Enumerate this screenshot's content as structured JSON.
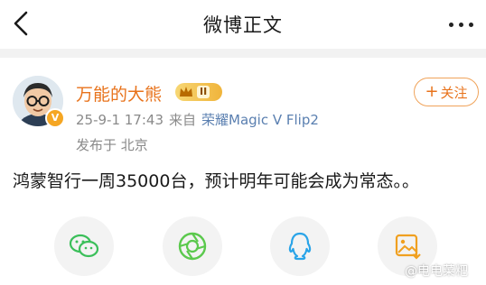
{
  "header": {
    "title": "微博正文",
    "back_icon": "chevron-left-icon",
    "more_icon": "more-dots-icon"
  },
  "post": {
    "author": {
      "name": "万能的大熊",
      "level": "II",
      "verified_badge": "V"
    },
    "follow_label": "关注",
    "follow_plus": "+",
    "date": "25-9-1 17:43",
    "from_label": "来自",
    "device": "荣耀Magic V Flip2",
    "location": "发布于 北京",
    "text": "鸿蒙智行一周35000台，预计明年可能会成为常态。。"
  },
  "share": {
    "icons": [
      "wechat-icon",
      "moments-icon",
      "qq-icon",
      "save-image-icon"
    ]
  },
  "watermark": "@电电菜粑",
  "colors": {
    "accent": "#e8731c",
    "wechat": "#3bbf5a",
    "moments": "#5bc94d",
    "qq": "#2aa4e8",
    "save": "#f0a020"
  }
}
